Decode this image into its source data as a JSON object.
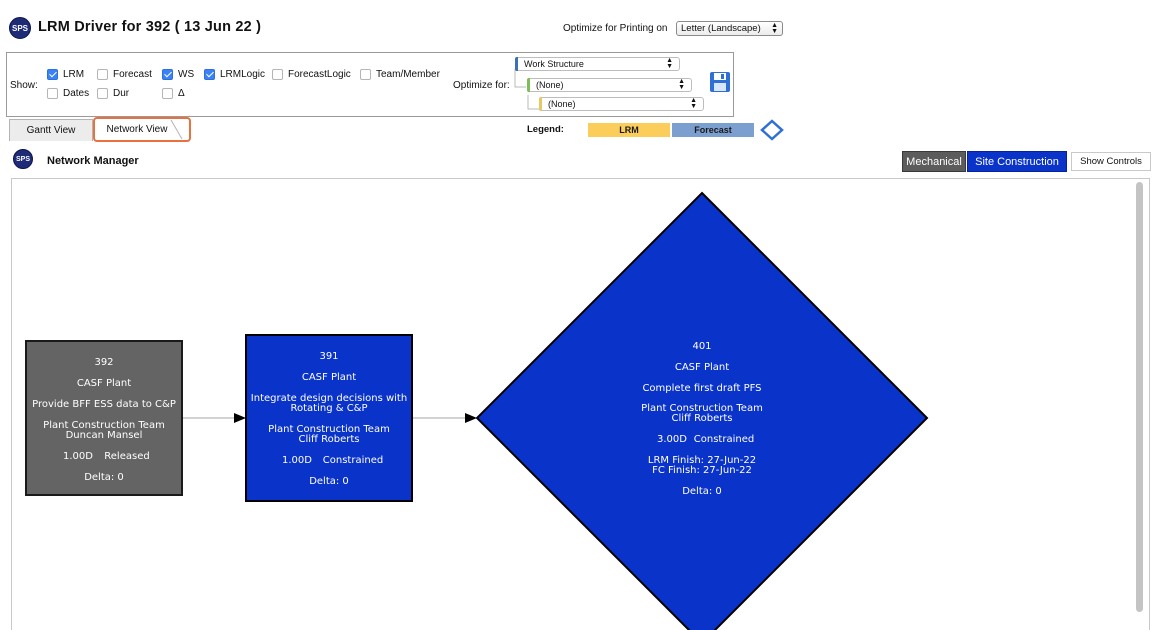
{
  "header": {
    "logo_text": "SPS",
    "title": "LRM Driver for 392 ( 13 Jun 22 )",
    "print_label": "Optimize for Printing on",
    "print_value": "Letter (Landscape)"
  },
  "show_panel": {
    "show_label": "Show:",
    "options": {
      "lrm": {
        "label": "LRM",
        "checked": true
      },
      "forecast": {
        "label": "Forecast",
        "checked": false
      },
      "ws": {
        "label": "WS",
        "checked": true
      },
      "lrmlogic": {
        "label": "LRMLogic",
        "checked": true
      },
      "forecastlogic": {
        "label": "ForecastLogic",
        "checked": false
      },
      "teammember": {
        "label": "Team/Member",
        "checked": false
      },
      "dates": {
        "label": "Dates",
        "checked": false
      },
      "dur": {
        "label": "Dur",
        "checked": false
      },
      "delta": {
        "label": "Δ",
        "checked": false
      }
    },
    "optimize_label": "Optimize for:",
    "level1": "Work Structure",
    "level2": "(None)",
    "level3": "(None)"
  },
  "tabs": {
    "gantt": "Gantt View",
    "network": "Network View"
  },
  "legend": {
    "label": "Legend:",
    "lrm": "LRM",
    "forecast": "Forecast",
    "lrm_color": "#fbcd5b",
    "forecast_color": "#7b9fcf"
  },
  "manager": {
    "logo_text": "SPS",
    "title": "Network Manager",
    "mechanical": "Mechanical",
    "site_construction": "Site Construction",
    "show_controls": "Show Controls"
  },
  "nodes": {
    "n392": {
      "id": "392",
      "area": "CASF Plant",
      "desc": "Provide BFF ESS data to C&P",
      "team": "Plant Construction Team",
      "person": "Duncan Mansel",
      "duration": "1.00D",
      "status": "Released",
      "delta": "Delta: 0"
    },
    "n391": {
      "id": "391",
      "area": "CASF Plant",
      "desc1": "Integrate design decisions with",
      "desc2": "Rotating & C&P",
      "team": "Plant Construction Team",
      "person": "Cliff Roberts",
      "duration": "1.00D",
      "status": "Constrained",
      "delta": "Delta: 0"
    },
    "n401": {
      "id": "401",
      "area": "CASF Plant",
      "desc": "Complete first draft PFS",
      "team": "Plant Construction Team",
      "person": "Cliff Roberts",
      "duration": "3.00D",
      "status": "Constrained",
      "lrm_finish": "LRM Finish: 27-Jun-22",
      "fc_finish": "FC Finish: 27-Jun-22",
      "delta": "Delta: 0"
    }
  },
  "colors": {
    "released_fill": "#646464",
    "constrained_fill": "#0a33c9",
    "segment_active": "#0a33c9",
    "segment_dark": "#5c5c5c",
    "tab_highlight": "#e8713f",
    "logo": "#1e2c78"
  }
}
